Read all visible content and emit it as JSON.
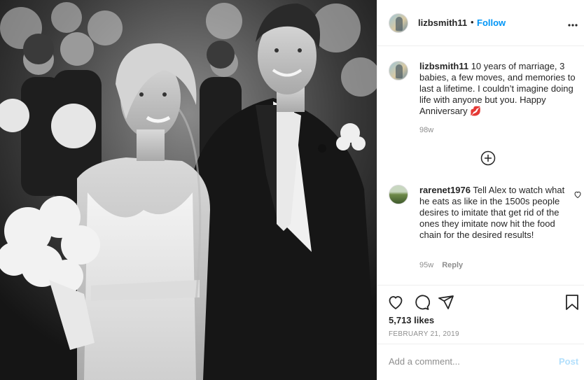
{
  "post": {
    "photo_alt": "",
    "username": "lizbsmith11",
    "follow_label": "Follow",
    "dot": "•"
  },
  "caption": {
    "username": "lizbsmith11",
    "text": "10 years of marriage, 3 babies, a few moves, and memories to last a lifetime. I couldn’t imagine doing life with anyone but you. Happy Anniversary 💋",
    "time": "98w"
  },
  "comment": {
    "username": "rarenet1976",
    "text": "Tell Alex to watch what he eats as like in the 1500s people desires to imitate that get rid of the ones they imitate now hit the food chain for the desired results!",
    "time": "95w",
    "reply_label": "Reply"
  },
  "stats": {
    "likes": "5,713 likes",
    "date": "February 21, 2019"
  },
  "add_comment": {
    "placeholder": "Add a comment...",
    "post_label": "Post"
  },
  "icons": {
    "more": "more-options-icon",
    "load_more": "plus-circle-icon",
    "heart": "heart-icon",
    "comment": "comment-icon",
    "share": "share-icon",
    "save": "bookmark-icon"
  },
  "colors": {
    "link": "#0095f6",
    "post_disabled": "#b2dffc",
    "muted": "#8e8e8e",
    "text": "#262626"
  }
}
